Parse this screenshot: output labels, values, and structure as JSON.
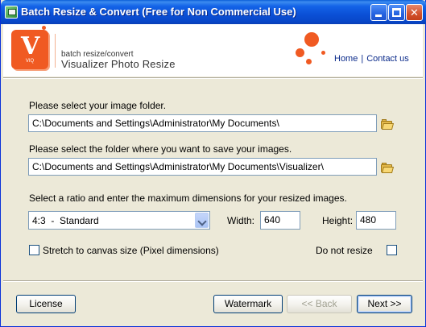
{
  "window": {
    "title": "Batch Resize & Convert (Free for Non Commercial Use)"
  },
  "banner": {
    "logo_letter": "V",
    "logo_sub": "VIQ",
    "subtitle": "batch resize/convert",
    "title": "Visualizer Photo Resize",
    "links": {
      "home": "Home",
      "separator": "|",
      "contact": "Contact us"
    },
    "accent_color": "#f05a22"
  },
  "source": {
    "label": "Please select your image folder.",
    "path": "C:\\Documents and Settings\\Administrator\\My Documents\\"
  },
  "destination": {
    "label": "Please select the folder where you want to save your images.",
    "path": "C:\\Documents and Settings\\Administrator\\My Documents\\Visualizer\\"
  },
  "ratio": {
    "label": "Select a ratio and enter the maximum dimensions for your resized images.",
    "selected": "4:3  -  Standard",
    "width_label": "Width:",
    "width_value": "640",
    "height_label": "Height:",
    "height_value": "480"
  },
  "options": {
    "stretch_label": "Stretch to canvas size (Pixel dimensions)",
    "stretch_checked": false,
    "no_resize_label": "Do not resize",
    "no_resize_checked": false
  },
  "buttons": {
    "license": "License",
    "watermark": "Watermark",
    "back": "<< Back",
    "next": "Next >>"
  }
}
